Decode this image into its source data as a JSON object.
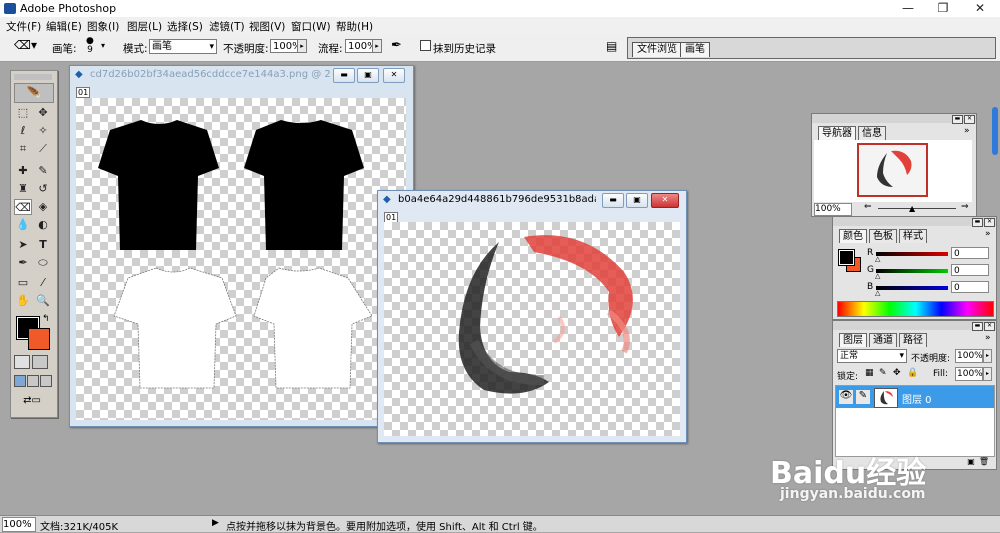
{
  "window": {
    "title": "Adobe Photoshop",
    "minimize": "—",
    "restore": "❐",
    "close": "✕"
  },
  "menu": [
    "文件(F)",
    "编辑(E)",
    "图象(I)",
    "图层(L)",
    "选择(S)",
    "滤镜(T)",
    "视图(V)",
    "窗口(W)",
    "帮助(H)"
  ],
  "options": {
    "brush_label": "画笔:",
    "brush_size": "9",
    "mode_label": "模式:",
    "mode_value": "画笔",
    "opacity_label": "不透明度:",
    "opacity_value": "100%",
    "flow_label": "流程:",
    "flow_value": "100%",
    "history_label": "抹到历史记录",
    "tab_file_browser": "文件浏览",
    "tab_brushes": "画笔"
  },
  "doc1": {
    "title": "cd7d26b02bf34aead56cddcce7e144a3.png @ 25...",
    "badge": "01"
  },
  "doc2": {
    "title": "b0a4e64a29d448861b796de9531b8ada.p...",
    "badge": "01"
  },
  "navigator": {
    "tabs": [
      "导航器",
      "信息"
    ],
    "zoom": "100%"
  },
  "color": {
    "tabs": [
      "颜色",
      "色板",
      "样式"
    ],
    "channels": [
      {
        "label": "R",
        "value": "0",
        "color": "#b00000"
      },
      {
        "label": "G",
        "value": "0",
        "color": "#00a000"
      },
      {
        "label": "B",
        "value": "0",
        "color": "#0000b0"
      }
    ],
    "foreground": "#000000",
    "background": "#f05a28"
  },
  "layers": {
    "tabs": [
      "图层",
      "通道",
      "路径"
    ],
    "blend_mode": "正常",
    "opacity_label": "不透明度:",
    "opacity_value": "100%",
    "lock_label": "锁定:",
    "fill_label": "Fill:",
    "fill_value": "100%",
    "layer_name": "图层 0"
  },
  "status": {
    "zoom": "100%",
    "doc_info": "文档:321K/405K",
    "hint": "点按并拖移以抹为背景色。要用附加选项，使用 Shift、Alt 和 Ctrl 键。"
  },
  "watermark": {
    "brand": "Baidu经验",
    "url": "jingyan.baidu.com"
  }
}
